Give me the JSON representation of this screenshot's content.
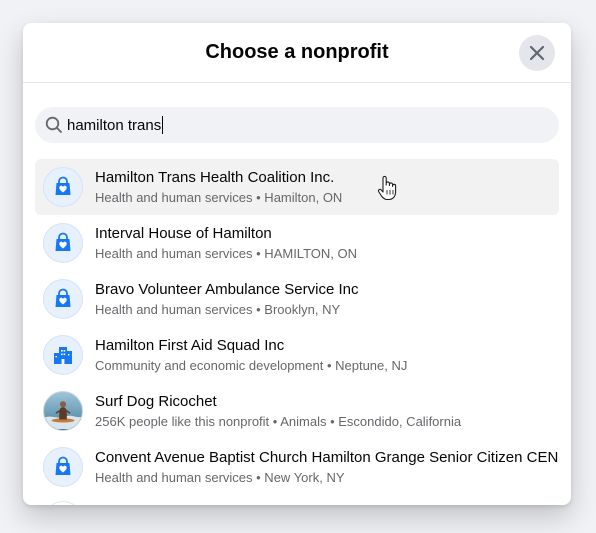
{
  "dialog": {
    "title": "Choose a nonprofit",
    "close_icon": "close-icon"
  },
  "search": {
    "icon": "search-icon",
    "value": "hamilton trans"
  },
  "results": [
    {
      "name": "Hamilton Trans Health Coalition Inc.",
      "subtitle": "Health and human services • Hamilton, ON",
      "icon": "heart-bag-icon",
      "hovered": true
    },
    {
      "name": "Interval House of Hamilton",
      "subtitle": "Health and human services • HAMILTON, ON",
      "icon": "heart-bag-icon"
    },
    {
      "name": "Bravo Volunteer Ambulance Service Inc",
      "subtitle": "Health and human services • Brooklyn, NY",
      "icon": "heart-bag-icon"
    },
    {
      "name": "Hamilton First Aid Squad Inc",
      "subtitle": "Community and economic development • Neptune, NJ",
      "icon": "buildings-icon"
    },
    {
      "name": "Surf Dog Ricochet",
      "subtitle": "256K people like this nonprofit • Animals • Escondido, California",
      "icon": "profile-photo"
    },
    {
      "name": "Convent Avenue Baptist Church Hamilton Grange Senior Citizen CEN",
      "subtitle": "Health and human services • New York, NY",
      "icon": "heart-bag-icon"
    }
  ],
  "colors": {
    "accent": "#1877f2",
    "hover_bg": "#f2f2f2",
    "secondary_text": "#65676b"
  }
}
